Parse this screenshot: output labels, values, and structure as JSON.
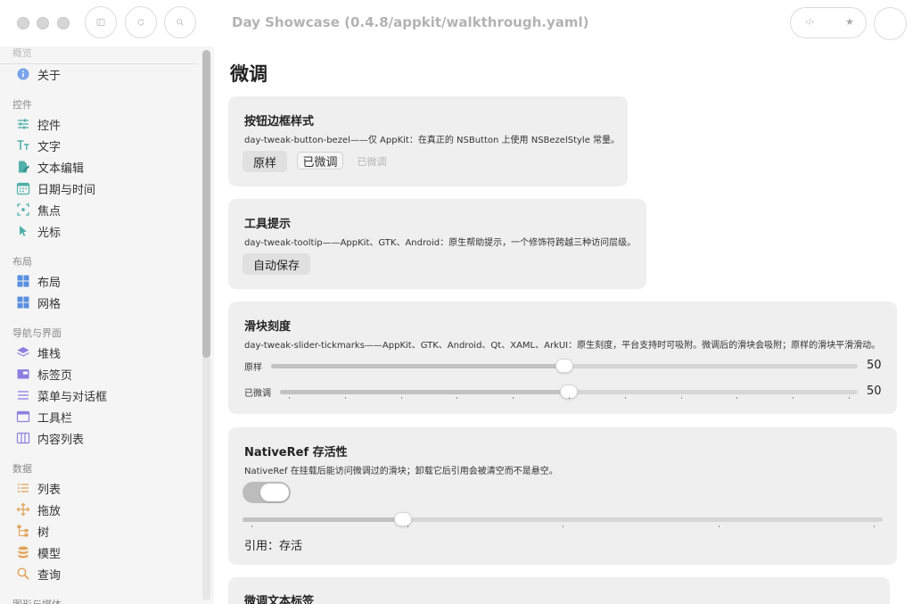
{
  "window": {
    "title": "Day Showcase (0.4.8/appkit/walkthrough.yaml)",
    "toolbar_icons": [
      "sidebar-icon",
      "refresh-icon",
      "search-icon"
    ],
    "right_pill": {
      "left_glyph": "‹/›",
      "right_glyph": "★"
    }
  },
  "sidebar": {
    "cut_section": "概览",
    "sections": [
      {
        "title": "",
        "items": [
          {
            "label": "关于",
            "icon": "info-icon"
          }
        ]
      },
      {
        "title": "控件",
        "items": [
          {
            "label": "控件",
            "icon": "sliders-icon"
          },
          {
            "label": "文字",
            "icon": "text-icon"
          },
          {
            "label": "文本编辑",
            "icon": "edit-icon"
          },
          {
            "label": "日期与时间",
            "icon": "calendar-icon"
          },
          {
            "label": "焦点",
            "icon": "focus-icon"
          },
          {
            "label": "光标",
            "icon": "cursor-icon"
          }
        ]
      },
      {
        "title": "布局",
        "items": [
          {
            "label": "布局",
            "icon": "layout-icon"
          },
          {
            "label": "网格",
            "icon": "grid-icon"
          }
        ]
      },
      {
        "title": "导航与界面",
        "items": [
          {
            "label": "堆栈",
            "icon": "stack-icon"
          },
          {
            "label": "标签页",
            "icon": "tabs-icon"
          },
          {
            "label": "菜单与对话框",
            "icon": "menu-icon"
          },
          {
            "label": "工具栏",
            "icon": "toolbar-icon"
          },
          {
            "label": "内容列表",
            "icon": "columns-icon"
          }
        ]
      },
      {
        "title": "数据",
        "items": [
          {
            "label": "列表",
            "icon": "list-icon"
          },
          {
            "label": "拖放",
            "icon": "move-icon"
          },
          {
            "label": "树",
            "icon": "tree-icon"
          },
          {
            "label": "模型",
            "icon": "database-icon"
          },
          {
            "label": "查询",
            "icon": "query-icon"
          }
        ]
      }
    ],
    "cut_bottom_section": "图形与媒体"
  },
  "main": {
    "title": "微调",
    "cards": {
      "bezel": {
        "title": "按钮边框样式",
        "desc": "day-tweak-button-bezel——仅 AppKit：在真正的 NSButton 上使用 NSBezelStyle 常量。",
        "buttons": [
          "原样",
          "已微调",
          "已微调"
        ]
      },
      "tooltip": {
        "title": "工具提示",
        "desc": "day-tweak-tooltip——AppKit、GTK、Android：原生帮助提示，一个修饰符跨越三种访问层级。",
        "button": "自动保存"
      },
      "slider": {
        "title": "滑块刻度",
        "desc": "day-tweak-slider-tickmarks——AppKit、GTK、Android、Qt、XAML、ArkUI：原生刻度，平台支持时可吸附。微调后的滑块会吸附；原样的滑块平滑滑动。",
        "rows": [
          {
            "label": "原样",
            "value": "50",
            "fraction": 0.5
          },
          {
            "label": "已微调",
            "value": "50",
            "fraction": 0.5
          }
        ]
      },
      "nativeref": {
        "title": "NativeRef 存活性",
        "desc": "NativeRef 在挂载后能访问微调过的滑块；卸载它后引用会被清空而不是悬空。",
        "toggle_on": true,
        "slider_fraction": 0.25,
        "ref_text": "引用：存活"
      },
      "label": {
        "title": "微调文本标签"
      }
    }
  },
  "colors": {
    "sidebar_bg": "#f5f5f5",
    "card_bg": "#efefef",
    "accent_blue": "#5a8fe0",
    "accent_teal": "#3fa7a0",
    "accent_orange": "#e2a45a",
    "accent_purple": "#8c7fe0"
  }
}
